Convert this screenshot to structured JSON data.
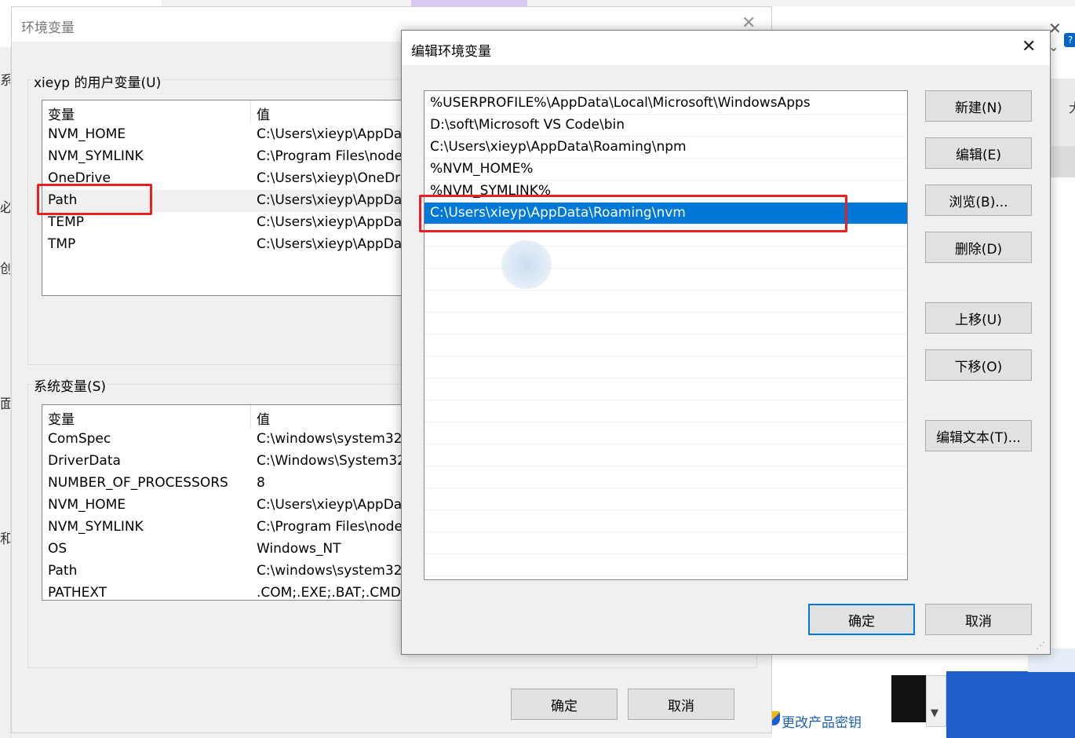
{
  "background": {
    "left_edge_chars": [
      "系",
      "必",
      "创",
      "面",
      "和"
    ],
    "right_edge_char": "大",
    "help_glyph": "?",
    "product_key_link": "更改产品密钥"
  },
  "env_dialog": {
    "title": "环境变量",
    "user_section_label": "xieyp 的用户变量(U)",
    "user_columns": [
      "变量",
      "值"
    ],
    "user_vars": [
      {
        "name": "NVM_HOME",
        "value": "C:\\Users\\xieyp\\AppDa"
      },
      {
        "name": "NVM_SYMLINK",
        "value": "C:\\Program Files\\node"
      },
      {
        "name": "OneDrive",
        "value": "C:\\Users\\xieyp\\OneDr"
      },
      {
        "name": "Path",
        "value": "C:\\Users\\xieyp\\AppDa"
      },
      {
        "name": "TEMP",
        "value": "C:\\Users\\xieyp\\AppDa"
      },
      {
        "name": "TMP",
        "value": "C:\\Users\\xieyp\\AppDa"
      }
    ],
    "user_selected_index": 3,
    "system_section_label": "系统变量(S)",
    "system_columns": [
      "变量",
      "值"
    ],
    "system_vars": [
      {
        "name": "ComSpec",
        "value": "C:\\windows\\system32"
      },
      {
        "name": "DriverData",
        "value": "C:\\Windows\\System32"
      },
      {
        "name": "NUMBER_OF_PROCESSORS",
        "value": "8"
      },
      {
        "name": "NVM_HOME",
        "value": "C:\\Users\\xieyp\\AppDa"
      },
      {
        "name": "NVM_SYMLINK",
        "value": "C:\\Program Files\\node"
      },
      {
        "name": "OS",
        "value": "Windows_NT"
      },
      {
        "name": "Path",
        "value": "C:\\windows\\system32"
      },
      {
        "name": "PATHEXT",
        "value": ".COM;.EXE;.BAT;.CMD"
      }
    ],
    "ok_label": "确定",
    "cancel_label": "取消"
  },
  "edit_dialog": {
    "title": "编辑环境变量",
    "entries": [
      "%USERPROFILE%\\AppData\\Local\\Microsoft\\WindowsApps",
      "D:\\soft\\Microsoft VS Code\\bin",
      "C:\\Users\\xieyp\\AppData\\Roaming\\npm",
      "%NVM_HOME%",
      "%NVM_SYMLINK%",
      "C:\\Users\\xieyp\\AppData\\Roaming\\nvm"
    ],
    "selected_index": 5,
    "buttons": {
      "new": "新建(N)",
      "edit": "编辑(E)",
      "browse": "浏览(B)...",
      "delete": "删除(D)",
      "move_up": "上移(U)",
      "move_down": "下移(O)",
      "edit_text": "编辑文本(T)...",
      "ok": "确定",
      "cancel": "取消"
    }
  },
  "colors": {
    "selection": "#0078d7",
    "highlight_box": "#e8211f",
    "dialog_bg": "#f0f0f0"
  }
}
